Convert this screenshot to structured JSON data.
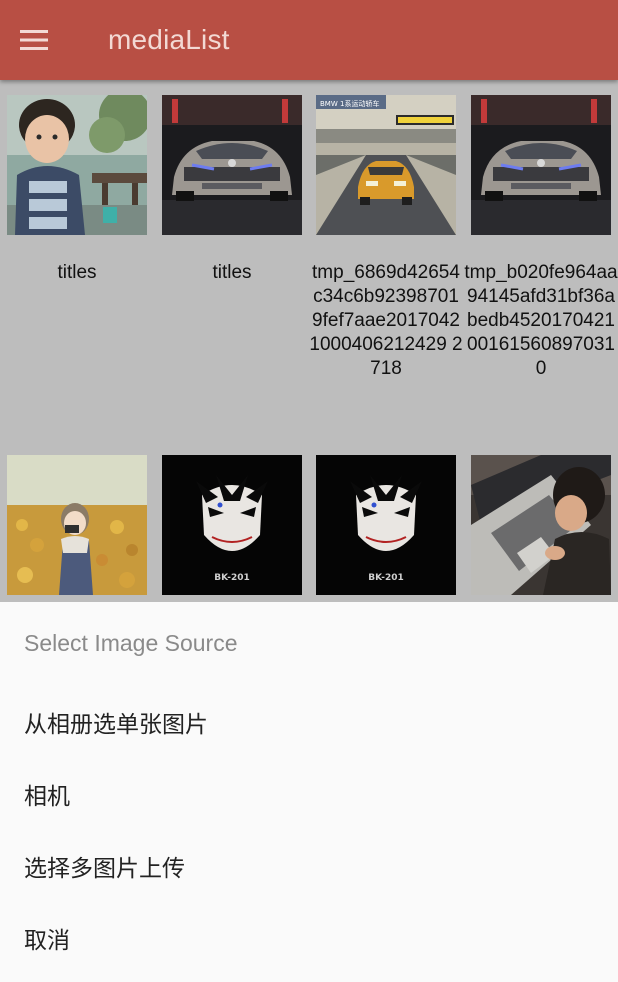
{
  "appbar": {
    "title": "mediaList",
    "menu_icon": "hamburger-menu-icon",
    "background": "#b84f44"
  },
  "grid": {
    "items": [
      {
        "caption": "titles",
        "image": "child-photo"
      },
      {
        "caption": "titles",
        "image": "silver-sports-car"
      },
      {
        "caption": "tmp_6869d42654c34c6b923987019fef7aae20170421000406212429 2718",
        "image": "orange-car-on-track"
      },
      {
        "caption": "tmp_b020fe964aa94145afd31bf36abedb452017042100161560897031 0",
        "image": "silver-sports-car"
      },
      {
        "caption": "",
        "image": "anime-girl-flowers"
      },
      {
        "caption": "",
        "image": "anime-mask-bk201"
      },
      {
        "caption": "",
        "image": "anime-mask-bk201"
      },
      {
        "caption": "",
        "image": "child-with-laptop"
      }
    ],
    "mask_label": "BK-201",
    "track_banner": "BMW 1系运动轿车"
  },
  "sheet": {
    "title": "Select Image Source",
    "options": [
      "从相册选单张图片",
      "相机",
      "选择多图片上传",
      "取消"
    ]
  },
  "colors": {
    "appbar": "#b84f44",
    "grid_background": "#bdbdbd",
    "sheet_background": "#fafafa",
    "sheet_title": "#8a8a8a"
  }
}
